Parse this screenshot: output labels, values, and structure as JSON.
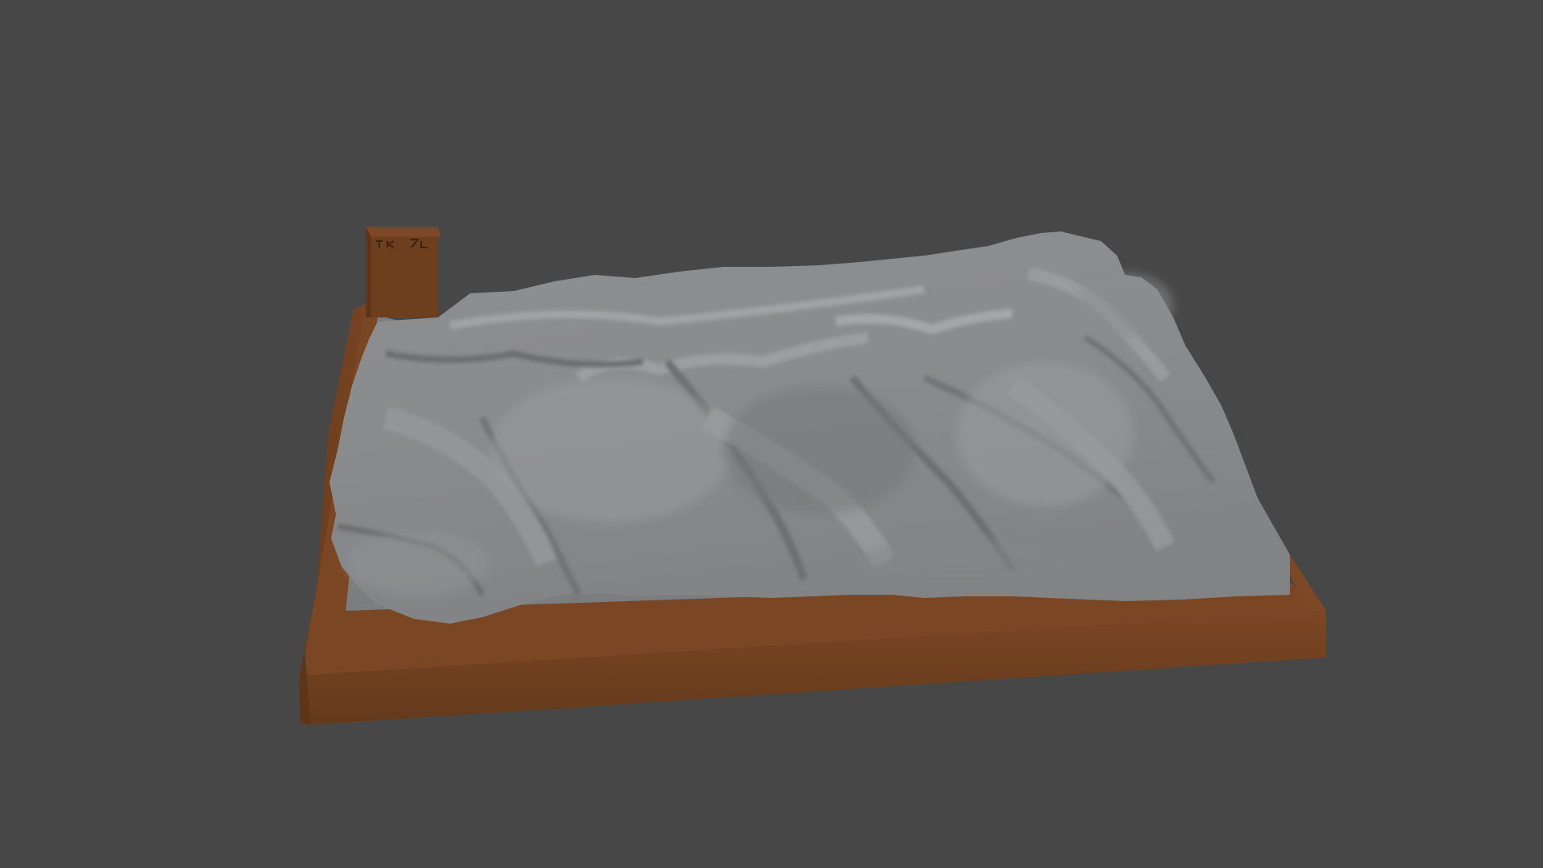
{
  "scene": {
    "background_color": "#474747",
    "base_color": "#6b3e1f",
    "base_top_color": "#7a4624",
    "terrain_color": "#8a8b8d",
    "terrain_highlight_color": "#a3a4a6",
    "terrain_shadow_color": "#5e5f61",
    "floor_color": "#7c7d7f",
    "objects": [
      "terrain-relief-model",
      "wooden-base",
      "label-tab"
    ]
  }
}
